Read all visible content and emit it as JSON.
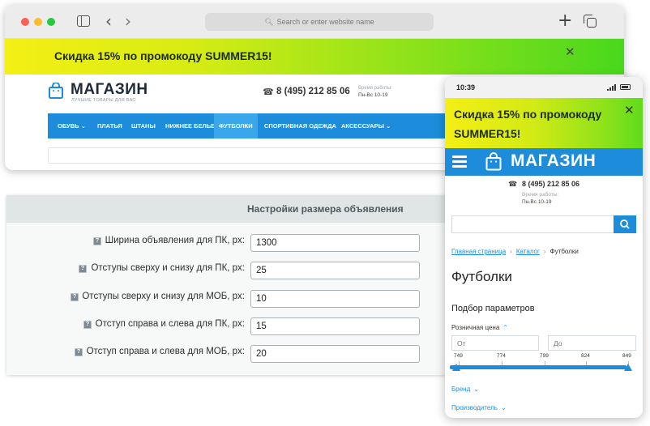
{
  "browser": {
    "address_placeholder": "Search or enter website name"
  },
  "promo": {
    "text": "Скидка 15% по промокоду SUMMER15!",
    "close": "✕"
  },
  "site": {
    "logo": "МАГАЗИН",
    "tagline": "ЛУЧШИЕ ТОВАРЫ ДЛЯ ВАС",
    "phone": "8 (495) 212 85 06",
    "hours_label": "Время работы:",
    "hours": "Пн-Вс 10-19",
    "nav": [
      {
        "label": "ОБУВЬ ⌄"
      },
      {
        "label": "ПЛАТЬЯ"
      },
      {
        "label": "ШТАНЫ"
      },
      {
        "label": "НИЖНЕЕ БЕЛЬЕ"
      },
      {
        "label": "ФУТБОЛКИ"
      },
      {
        "label": "СПОРТИВНАЯ ОДЕЖДА"
      },
      {
        "label": "АКСЕССУАРЫ ⌄"
      }
    ],
    "active_nav": "ФУТБОЛКИ"
  },
  "settings": {
    "title": "Настройки размера объявления",
    "help_glyph": "?",
    "rows": [
      {
        "label": "Ширина объявления для ПК, px:",
        "value": "1300"
      },
      {
        "label": "Отступы сверху и снизу для ПК, px:",
        "value": "25"
      },
      {
        "label": "Отступы сверху и снизу для МОБ, px:",
        "value": "10"
      },
      {
        "label": "Отступ справа и слева для ПК, px:",
        "value": "15"
      },
      {
        "label": "Отступ справа и слева для МОБ, px:",
        "value": "20"
      }
    ]
  },
  "mobile": {
    "time": "10:39",
    "promo_text": "Скидка 15% по промокоду SUMMER15!",
    "logo": "МАГАЗИН",
    "phone": "8 (495) 212 85 06",
    "hours_label": "Время работы:",
    "hours": "Пн-Вс 10-19",
    "breadcrumbs": {
      "home": "Главная страница",
      "catalog": "Каталог",
      "current": "Футболки"
    },
    "page_title": "Футболки",
    "filter_title": "Подбор параметров",
    "price_label": "Розничная цена",
    "price_from_placeholder": "От",
    "price_to_placeholder": "До",
    "price_ticks": [
      "749",
      "774",
      "799",
      "824",
      "849"
    ],
    "price_range": {
      "min": 749,
      "max": 849,
      "selected_min": 749,
      "selected_max": 849
    },
    "filters": [
      {
        "label": "Бренд"
      },
      {
        "label": "Производитель"
      }
    ]
  },
  "colors": {
    "brand_blue": "#1d8ddb",
    "promo_start": "#f4ef14",
    "promo_end": "#49d81d"
  }
}
